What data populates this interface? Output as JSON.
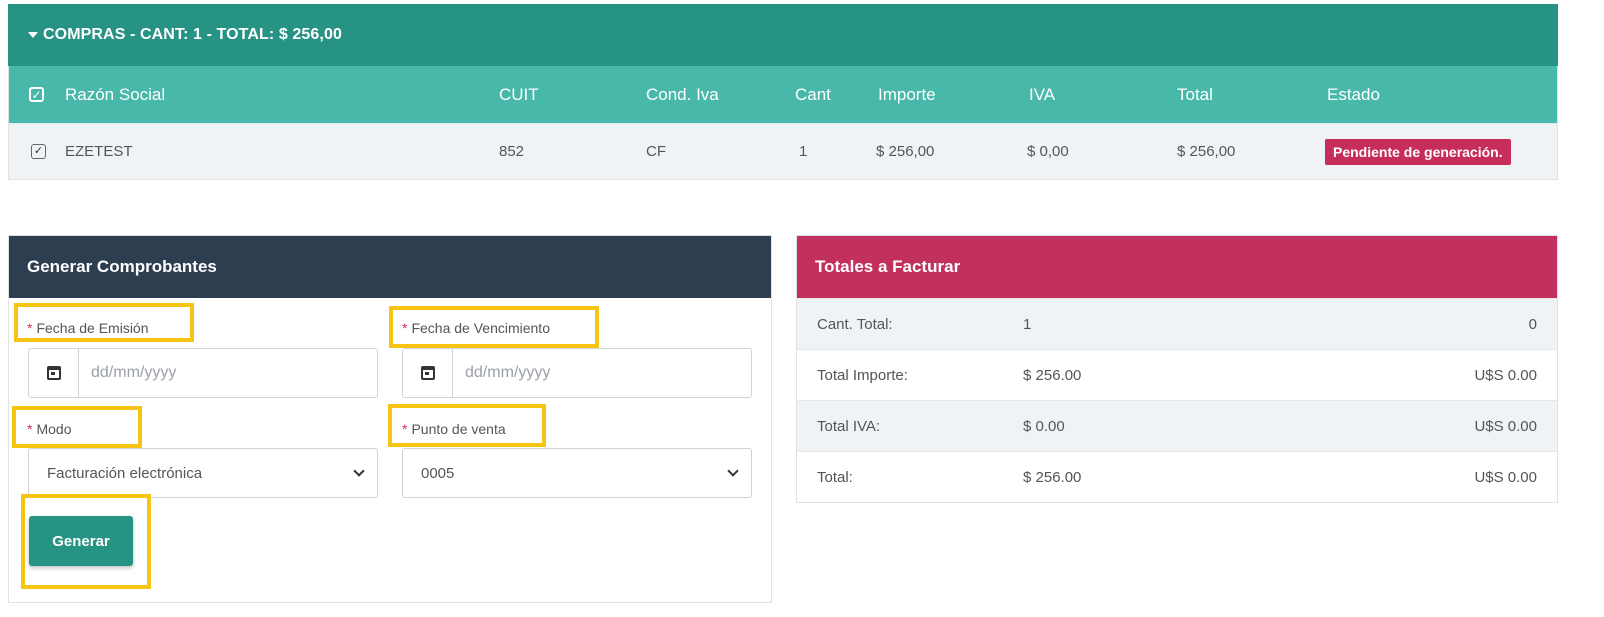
{
  "compras": {
    "header": "COMPRAS - CANT: 1 - TOTAL: $ 256,00",
    "columns": {
      "razon_social": "Razón Social",
      "cuit": "CUIT",
      "cond_iva": "Cond. Iva",
      "cant": "Cant",
      "importe": "Importe",
      "iva": "IVA",
      "total": "Total",
      "estado": "Estado"
    },
    "rows": [
      {
        "razon_social": "EZETEST",
        "cuit": "852",
        "cond_iva": "CF",
        "cant": "1",
        "importe": "$ 256,00",
        "iva": "$ 0,00",
        "total": "$ 256,00",
        "estado": "Pendiente de generación.",
        "checked": true
      }
    ]
  },
  "generar": {
    "title": "Generar Comprobantes",
    "required_mark": "*",
    "fecha_emision_label": "Fecha de Emisión",
    "fecha_emision_placeholder": "dd/mm/yyyy",
    "fecha_vencimiento_label": "Fecha de Vencimiento",
    "fecha_vencimiento_placeholder": "dd/mm/yyyy",
    "modo_label": "Modo",
    "modo_value": "Facturación electrónica",
    "punto_venta_label": "Punto de venta",
    "punto_venta_value": "0005",
    "button_label": "Generar"
  },
  "totales": {
    "title": "Totales a Facturar",
    "rows": [
      {
        "label": "Cant. Total:",
        "value": "1",
        "usd": "0"
      },
      {
        "label": "Total Importe:",
        "value": "$ 256.00",
        "usd": "U$S 0.00"
      },
      {
        "label": "Total IVA:",
        "value": "$ 0.00",
        "usd": "U$S 0.00"
      },
      {
        "label": "Total:",
        "value": "$ 256.00",
        "usd": "U$S 0.00"
      }
    ]
  },
  "colors": {
    "compras_header": "#279385",
    "table_header": "#47b8aa",
    "generar_header": "#2c3e50",
    "totales_header": "#c2305d",
    "badge": "#c72d5b",
    "highlight": "#f6c514"
  },
  "icons": {
    "caret": "caret-down-icon",
    "calendar": "calendar-icon",
    "chevron": "chevron-down-icon",
    "checkbox": "checkbox-checked-icon"
  }
}
